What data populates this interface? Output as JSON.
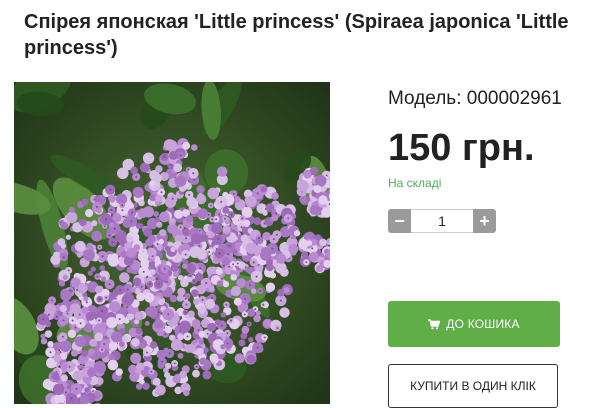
{
  "product": {
    "title": "Спірея японская 'Little princess' (Spiraea japonica 'Little princess')",
    "image_alt": "spiraea-flower-photo"
  },
  "info": {
    "model_label": "Модель:",
    "model_value": "000002961",
    "price": "150 грн.",
    "stock": "На складі"
  },
  "quantity": {
    "minus": "−",
    "value": "1",
    "plus": "+"
  },
  "buttons": {
    "add_to_cart": "ДО КОШИКА",
    "buy_one_click": "КУПИТИ В ОДИН КЛІК"
  },
  "colors": {
    "accent_green": "#5fae48",
    "stock_green": "#4caf50",
    "qty_gray": "#9a9a9a"
  },
  "icons": {
    "cart": "cart-icon"
  }
}
